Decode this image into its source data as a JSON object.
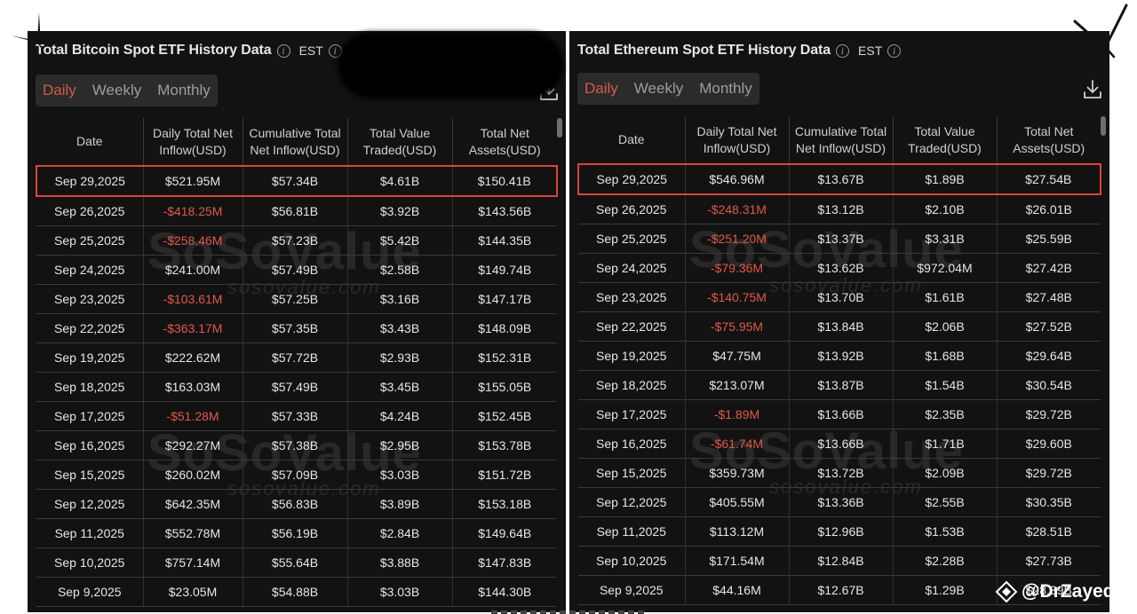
{
  "btc_panel": {
    "title": "Total Bitcoin Spot ETF History Data",
    "timezone": "EST",
    "tabs": [
      {
        "label": "Daily",
        "active": true
      },
      {
        "label": "Weekly",
        "active": false
      },
      {
        "label": "Monthly",
        "active": false
      }
    ],
    "columns": [
      "Date",
      "Daily Total Net\nInflow(USD)",
      "Cumulative Total\nNet Inflow(USD)",
      "Total Value\nTraded(USD)",
      "Total Net\nAssets(USD)"
    ],
    "rows": [
      {
        "date": "Sep 29,2025",
        "inflow": "$521.95M",
        "cumulative": "$57.34B",
        "traded": "$4.61B",
        "assets": "$150.41B",
        "negative": false,
        "highlighted": true
      },
      {
        "date": "Sep 26,2025",
        "inflow": "-$418.25M",
        "cumulative": "$56.81B",
        "traded": "$3.92B",
        "assets": "$143.56B",
        "negative": true,
        "highlighted": false
      },
      {
        "date": "Sep 25,2025",
        "inflow": "-$258.46M",
        "cumulative": "$57.23B",
        "traded": "$5.42B",
        "assets": "$144.35B",
        "negative": true,
        "highlighted": false
      },
      {
        "date": "Sep 24,2025",
        "inflow": "$241.00M",
        "cumulative": "$57.49B",
        "traded": "$2.58B",
        "assets": "$149.74B",
        "negative": false,
        "highlighted": false
      },
      {
        "date": "Sep 23,2025",
        "inflow": "-$103.61M",
        "cumulative": "$57.25B",
        "traded": "$3.16B",
        "assets": "$147.17B",
        "negative": true,
        "highlighted": false
      },
      {
        "date": "Sep 22,2025",
        "inflow": "-$363.17M",
        "cumulative": "$57.35B",
        "traded": "$3.43B",
        "assets": "$148.09B",
        "negative": true,
        "highlighted": false
      },
      {
        "date": "Sep 19,2025",
        "inflow": "$222.62M",
        "cumulative": "$57.72B",
        "traded": "$2.93B",
        "assets": "$152.31B",
        "negative": false,
        "highlighted": false
      },
      {
        "date": "Sep 18,2025",
        "inflow": "$163.03M",
        "cumulative": "$57.49B",
        "traded": "$3.45B",
        "assets": "$155.05B",
        "negative": false,
        "highlighted": false
      },
      {
        "date": "Sep 17,2025",
        "inflow": "-$51.28M",
        "cumulative": "$57.33B",
        "traded": "$4.24B",
        "assets": "$152.45B",
        "negative": true,
        "highlighted": false
      },
      {
        "date": "Sep 16,2025",
        "inflow": "$292.27M",
        "cumulative": "$57.38B",
        "traded": "$2.95B",
        "assets": "$153.78B",
        "negative": false,
        "highlighted": false
      },
      {
        "date": "Sep 15,2025",
        "inflow": "$260.02M",
        "cumulative": "$57.09B",
        "traded": "$3.03B",
        "assets": "$151.72B",
        "negative": false,
        "highlighted": false
      },
      {
        "date": "Sep 12,2025",
        "inflow": "$642.35M",
        "cumulative": "$56.83B",
        "traded": "$3.89B",
        "assets": "$153.18B",
        "negative": false,
        "highlighted": false
      },
      {
        "date": "Sep 11,2025",
        "inflow": "$552.78M",
        "cumulative": "$56.19B",
        "traded": "$2.84B",
        "assets": "$149.64B",
        "negative": false,
        "highlighted": false
      },
      {
        "date": "Sep 10,2025",
        "inflow": "$757.14M",
        "cumulative": "$55.64B",
        "traded": "$3.88B",
        "assets": "$147.83B",
        "negative": false,
        "highlighted": false
      },
      {
        "date": "Sep 9,2025",
        "inflow": "$23.05M",
        "cumulative": "$54.88B",
        "traded": "$3.03B",
        "assets": "$144.30B",
        "negative": false,
        "highlighted": false
      }
    ]
  },
  "eth_panel": {
    "title": "Total Ethereum Spot ETF History Data",
    "timezone": "EST",
    "tabs": [
      {
        "label": "Daily",
        "active": true
      },
      {
        "label": "Weekly",
        "active": false
      },
      {
        "label": "Monthly",
        "active": false
      }
    ],
    "columns": [
      "Date",
      "Daily Total Net\nInflow(USD)",
      "Cumulative Total\nNet Inflow(USD)",
      "Total Value\nTraded(USD)",
      "Total Net\nAssets(USD)"
    ],
    "rows": [
      {
        "date": "Sep 29,2025",
        "inflow": "$546.96M",
        "cumulative": "$13.67B",
        "traded": "$1.89B",
        "assets": "$27.54B",
        "negative": false,
        "highlighted": true
      },
      {
        "date": "Sep 26,2025",
        "inflow": "-$248.31M",
        "cumulative": "$13.12B",
        "traded": "$2.10B",
        "assets": "$26.01B",
        "negative": true,
        "highlighted": false
      },
      {
        "date": "Sep 25,2025",
        "inflow": "-$251.20M",
        "cumulative": "$13.37B",
        "traded": "$3.31B",
        "assets": "$25.59B",
        "negative": true,
        "highlighted": false
      },
      {
        "date": "Sep 24,2025",
        "inflow": "-$79.36M",
        "cumulative": "$13.62B",
        "traded": "$972.04M",
        "assets": "$27.42B",
        "negative": true,
        "highlighted": false
      },
      {
        "date": "Sep 23,2025",
        "inflow": "-$140.75M",
        "cumulative": "$13.70B",
        "traded": "$1.61B",
        "assets": "$27.48B",
        "negative": true,
        "highlighted": false
      },
      {
        "date": "Sep 22,2025",
        "inflow": "-$75.95M",
        "cumulative": "$13.84B",
        "traded": "$2.06B",
        "assets": "$27.52B",
        "negative": true,
        "highlighted": false
      },
      {
        "date": "Sep 19,2025",
        "inflow": "$47.75M",
        "cumulative": "$13.92B",
        "traded": "$1.68B",
        "assets": "$29.64B",
        "negative": false,
        "highlighted": false
      },
      {
        "date": "Sep 18,2025",
        "inflow": "$213.07M",
        "cumulative": "$13.87B",
        "traded": "$1.54B",
        "assets": "$30.54B",
        "negative": false,
        "highlighted": false
      },
      {
        "date": "Sep 17,2025",
        "inflow": "-$1.89M",
        "cumulative": "$13.66B",
        "traded": "$2.35B",
        "assets": "$29.72B",
        "negative": true,
        "highlighted": false
      },
      {
        "date": "Sep 16,2025",
        "inflow": "-$61.74M",
        "cumulative": "$13.66B",
        "traded": "$1.71B",
        "assets": "$29.60B",
        "negative": true,
        "highlighted": false
      },
      {
        "date": "Sep 15,2025",
        "inflow": "$359.73M",
        "cumulative": "$13.72B",
        "traded": "$2.09B",
        "assets": "$29.72B",
        "negative": false,
        "highlighted": false
      },
      {
        "date": "Sep 12,2025",
        "inflow": "$405.55M",
        "cumulative": "$13.36B",
        "traded": "$2.55B",
        "assets": "$30.35B",
        "negative": false,
        "highlighted": false
      },
      {
        "date": "Sep 11,2025",
        "inflow": "$113.12M",
        "cumulative": "$12.96B",
        "traded": "$1.53B",
        "assets": "$28.51B",
        "negative": false,
        "highlighted": false
      },
      {
        "date": "Sep 10,2025",
        "inflow": "$171.54M",
        "cumulative": "$12.84B",
        "traded": "$2.28B",
        "assets": "$27.73B",
        "negative": false,
        "highlighted": false
      },
      {
        "date": "Sep 9,2025",
        "inflow": "$44.16M",
        "cumulative": "$12.67B",
        "traded": "$1.29B",
        "assets": "$28.39B",
        "negative": false,
        "highlighted": false
      }
    ]
  },
  "watermark": {
    "main": "SoSoValue",
    "sub": "sosovalue.com"
  },
  "credit": "@DrZayed",
  "colors": {
    "panel_bg": "#121212",
    "negative": "#e0584a",
    "highlight_border": "#d9463a",
    "active_tab": "#d45a4a"
  },
  "icons": {
    "info": "info-circle-icon",
    "download": "download-icon",
    "credit": "diamond-logo-icon"
  }
}
